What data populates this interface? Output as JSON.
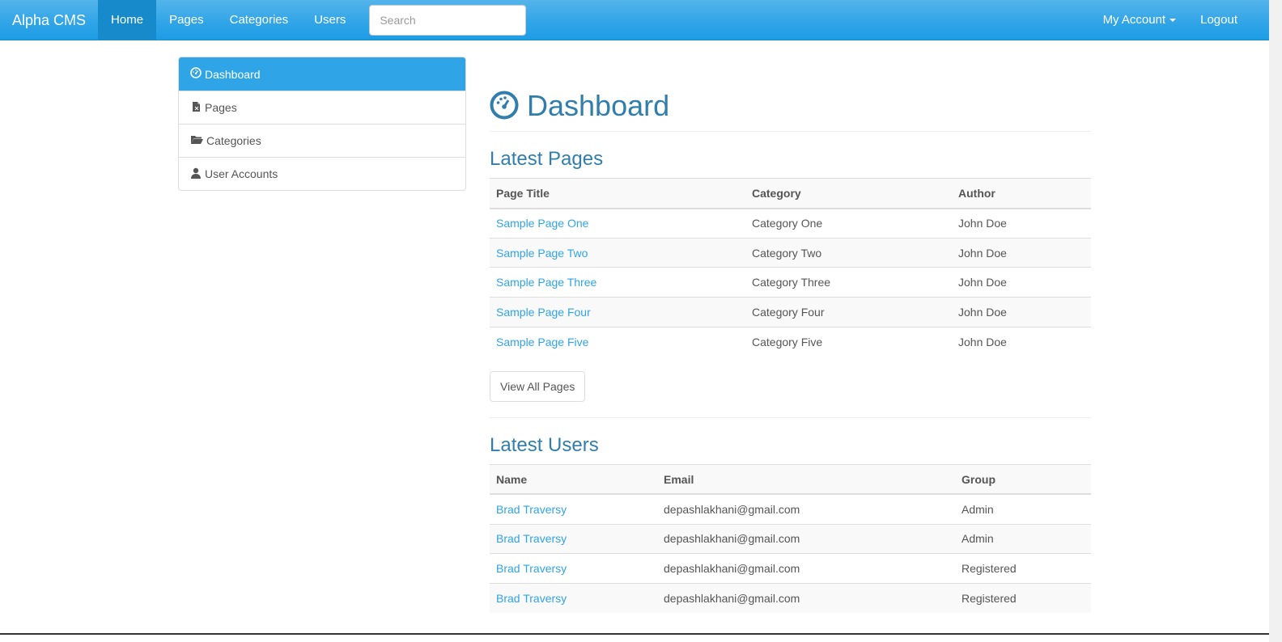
{
  "navbar": {
    "brand": "Alpha CMS",
    "links": [
      "Home",
      "Pages",
      "Categories",
      "Users"
    ],
    "search_placeholder": "Search",
    "account": "My Account",
    "logout": "Logout"
  },
  "sidebar": {
    "items": [
      {
        "label": "Dashboard",
        "icon": "dashboard-icon"
      },
      {
        "label": "Pages",
        "icon": "file-icon"
      },
      {
        "label": "Categories",
        "icon": "folder-open-icon"
      },
      {
        "label": "User Accounts",
        "icon": "user-icon"
      }
    ]
  },
  "main": {
    "title": "Dashboard",
    "latest_pages": {
      "title": "Latest Pages",
      "headers": [
        "Page Title",
        "Category",
        "Author"
      ],
      "rows": [
        [
          "Sample Page One",
          "Category One",
          "John Doe"
        ],
        [
          "Sample Page Two",
          "Category Two",
          "John Doe"
        ],
        [
          "Sample Page Three",
          "Category Three",
          "John Doe"
        ],
        [
          "Sample Page Four",
          "Category Four",
          "John Doe"
        ],
        [
          "Sample Page Five",
          "Category Five",
          "John Doe"
        ]
      ],
      "button": "View All Pages"
    },
    "latest_users": {
      "title": "Latest Users",
      "headers": [
        "Name",
        "Email",
        "Group"
      ],
      "rows": [
        [
          "Brad Traversy",
          "depashlakhani@gmail.com",
          "Admin"
        ],
        [
          "Brad Traversy",
          "depashlakhani@gmail.com",
          "Admin"
        ],
        [
          "Brad Traversy",
          "depashlakhani@gmail.com",
          "Registered"
        ],
        [
          "Brad Traversy",
          "depashlakhani@gmail.com",
          "Registered"
        ]
      ]
    }
  },
  "colors": {
    "primary": "#2fa4e7",
    "heading": "#317eac",
    "text": "#555555"
  }
}
